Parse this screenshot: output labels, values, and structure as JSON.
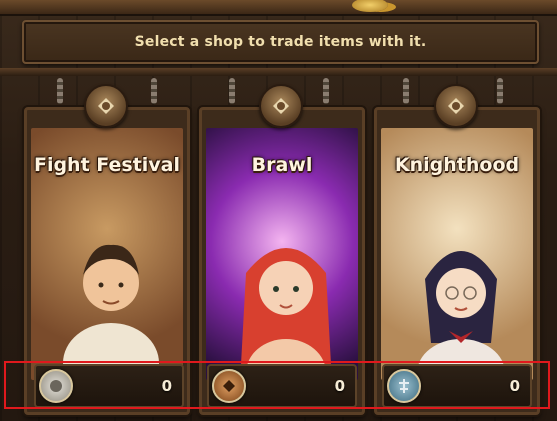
{
  "header": {
    "instruction": "Select a shop to trade items with it."
  },
  "shops": [
    {
      "name": "Fight Festival",
      "currency_amount": "0",
      "currency_icon": "fight-token-icon"
    },
    {
      "name": "Brawl",
      "currency_amount": "0",
      "currency_icon": "brawl-token-icon"
    },
    {
      "name": "Knighthood",
      "currency_amount": "0",
      "currency_icon": "knighthood-token-icon"
    }
  ],
  "colors": {
    "highlight": "#e0191d",
    "title_text": "#fff4df",
    "banner_text": "#f1dfae"
  }
}
